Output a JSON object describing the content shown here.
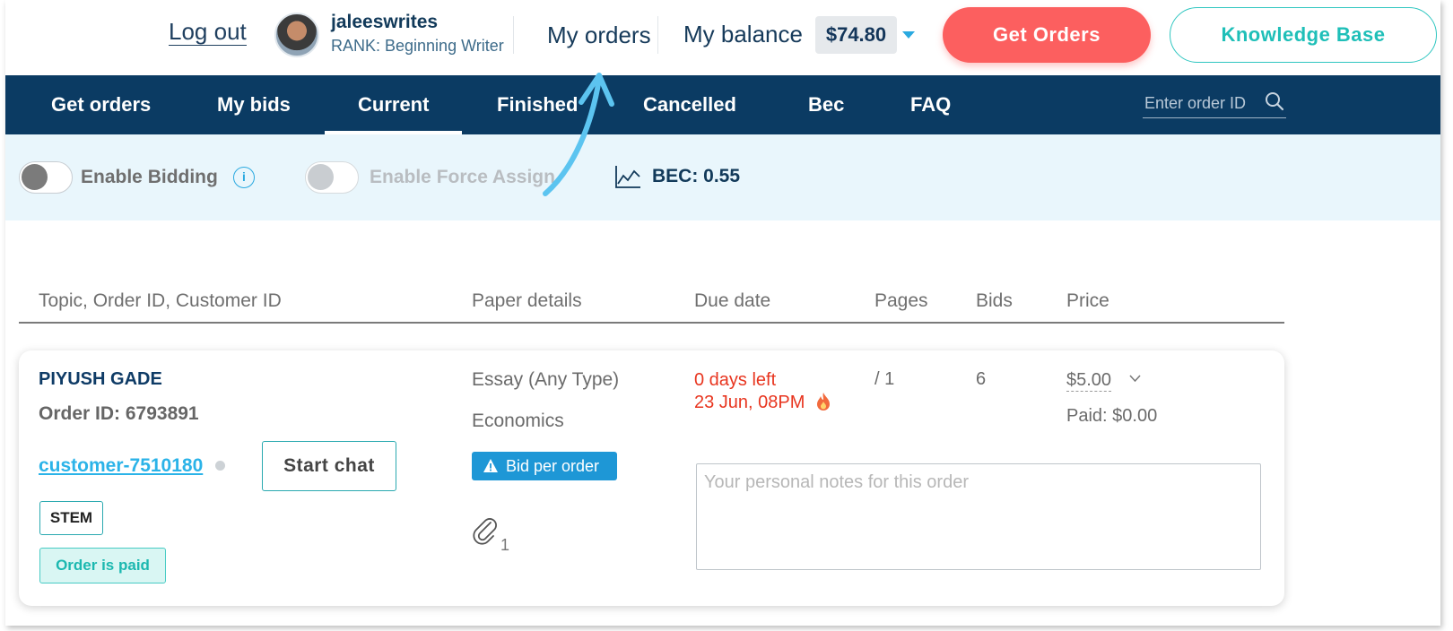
{
  "header": {
    "logout_label": "Log out",
    "username": "jaleeswrites",
    "rank": "RANK: Beginning Writer",
    "my_orders_label": "My orders",
    "my_balance_label": "My balance",
    "balance_value": "$74.80",
    "get_orders_label": "Get Orders",
    "knowledge_base_label": "Knowledge Base"
  },
  "nav": {
    "items": [
      {
        "label": "Get orders"
      },
      {
        "label": "My bids"
      },
      {
        "label": "Current",
        "active": true
      },
      {
        "label": "Finished"
      },
      {
        "label": "Cancelled"
      },
      {
        "label": "Bec"
      },
      {
        "label": "FAQ"
      }
    ],
    "search_placeholder": "Enter order ID"
  },
  "filters": {
    "enable_bidding_label": "Enable Bidding",
    "enable_bidding_on": false,
    "enable_force_assign_label": "Enable Force Assign",
    "enable_force_assign_on": false,
    "info_icon_text": "i",
    "bec_label": "BEC: 0.55"
  },
  "table": {
    "columns": [
      "Topic, Order ID, Customer ID",
      "Paper details",
      "Due date",
      "Pages",
      "Bids",
      "Price"
    ]
  },
  "order": {
    "topic": "PIYUSH GADE",
    "order_id": "Order ID: 6793891",
    "customer": "customer-7510180",
    "start_chat_label": "Start chat",
    "tag": "STEM",
    "paid_badge": "Order is paid",
    "paper_type": "Essay (Any Type)",
    "subject": "Economics",
    "bid_badge": "Bid per order",
    "attachments": "1",
    "days_left": "0 days left",
    "due_date": "23 Jun, 08PM",
    "pages": "/ 1",
    "bids": "6",
    "price": "$5.00",
    "paid": "Paid: $0.00",
    "notes_placeholder": "Your personal notes for this order"
  },
  "colors": {
    "nav_bg": "#0b3b63",
    "get_orders_bg": "#fc5f5f",
    "accent_teal": "#2fc6c0",
    "accent_blue": "#2aa9e0",
    "due_red": "#e8351f",
    "strip_bg": "#e9f6fc"
  },
  "icons": [
    "avatar",
    "caret-down-icon",
    "search-icon",
    "info-icon",
    "chart-line-icon",
    "warning-icon",
    "paperclip-icon",
    "fire-icon",
    "chevron-down-icon",
    "arrow-annotation"
  ]
}
